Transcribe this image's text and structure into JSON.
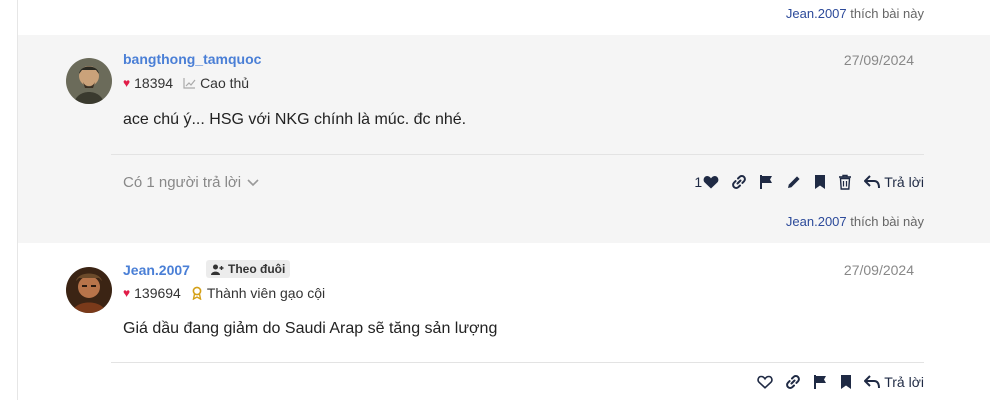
{
  "top_likes": {
    "liker": "Jean.2007",
    "text": "thích bài này"
  },
  "posts": [
    {
      "username": "bangthong_tamquoc",
      "date": "27/09/2024",
      "points": "18394",
      "rank": "Cao thủ",
      "content": "ace chú ý... HSG với NKG chính là múc. đc nhé.",
      "replies_label": "Có 1 người trả lời",
      "like_count": "1",
      "reply_label": "Trả lời",
      "likes": {
        "liker": "Jean.2007",
        "text": "thích bài này"
      }
    },
    {
      "username": "Jean.2007",
      "follow_label": "Theo đuôi",
      "date": "27/09/2024",
      "points": "139694",
      "rank": "Thành viên gạo cội",
      "content": "Giá dầu đang giảm do Saudi Arap sẽ tăng sản lượng",
      "reply_label": "Trả lời"
    }
  ],
  "colors": {
    "accent": "#4a7fd6",
    "heart": "#e11d48",
    "icon": "#1f2a44",
    "rank_gold": "#d4a017"
  }
}
